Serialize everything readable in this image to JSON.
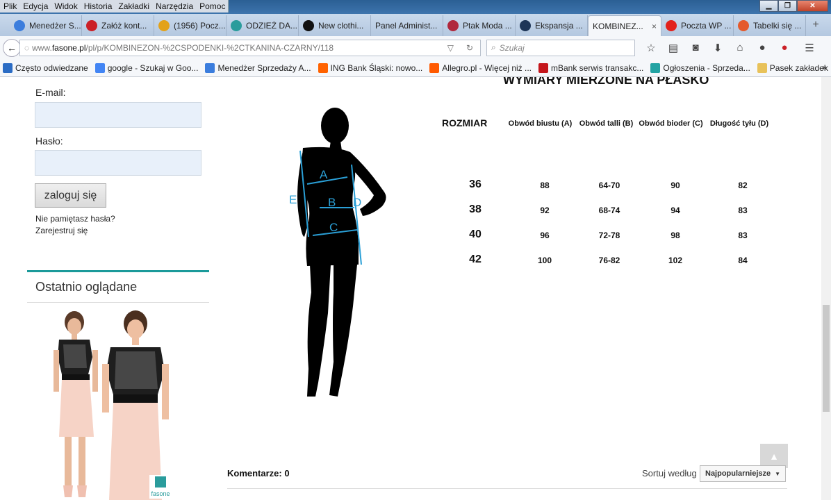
{
  "menubar": [
    "Plik",
    "Edycja",
    "Widok",
    "Historia",
    "Zakładki",
    "Narzędzia",
    "Pomoc"
  ],
  "tabs": [
    {
      "label": "Menedżer S...",
      "icon": "messenger-icon",
      "color": "#3b7ddd"
    },
    {
      "label": "Załóż kont...",
      "icon": "pinterest-icon",
      "color": "#cb2027"
    },
    {
      "label": "(1956) Pocz...",
      "icon": "mail-icon",
      "color": "#e3a21a"
    },
    {
      "label": "ODZIEŻ DA...",
      "icon": "shop-icon",
      "color": "#2a9c9c"
    },
    {
      "label": "New clothi...",
      "icon": "circle-icon",
      "color": "#111111"
    },
    {
      "label": "Panel Administ...",
      "icon": "",
      "color": ""
    },
    {
      "label": "Ptak Moda ...",
      "icon": "bird-icon",
      "color": "#b0283c"
    },
    {
      "label": "Ekspansja ...",
      "icon": "chart-icon",
      "color": "#1d3557"
    },
    {
      "label": "KOMBINEZ...",
      "icon": "",
      "color": "",
      "active": true
    },
    {
      "label": "Poczta WP ...",
      "icon": "wp-icon",
      "color": "#e2211c"
    },
    {
      "label": "Tabelki się ...",
      "icon": "lifebuoy-icon",
      "color": "#e45a2c"
    }
  ],
  "close_glyph": "×",
  "newtab_glyph": "+",
  "url": {
    "prefix": "www.",
    "host": "fasone.pl",
    "path": "/pl/p/KOMBINEZON-%2CSPODENKI-%2CTKANINA-CZARNY/118"
  },
  "search_placeholder": "Szukaj",
  "bookmarks": [
    {
      "label": "Często odwiedzane",
      "color": "#2b6cc4"
    },
    {
      "label": "google - Szukaj w Goo...",
      "color": "#4285f4"
    },
    {
      "label": "Menedżer Sprzedaży A...",
      "color": "#3b7ddd"
    },
    {
      "label": "ING Bank Śląski: nowo...",
      "color": "#ff6200"
    },
    {
      "label": "Allegro.pl - Więcej niż ...",
      "color": "#ff5a00"
    },
    {
      "label": "mBank serwis transakc...",
      "color": "#c4161c"
    },
    {
      "label": "Ogłoszenia - Sprzeda...",
      "color": "#23a3a3"
    },
    {
      "label": "Pasek zakładek",
      "color": "#e8c25a"
    }
  ],
  "login": {
    "email_label": "E-mail:",
    "password_label": "Hasło:",
    "button": "zaloguj się",
    "forgot": "Nie pamiętasz hasła?",
    "register": "Zarejestruj się"
  },
  "recent_title": "Ostatnio oglądane",
  "recent_logo": "fasone",
  "size_table": {
    "title": "WYMIARY MIERZONE NA PŁASKO",
    "size_header": "ROZMIAR",
    "headers": [
      "Obwód biustu (A)",
      "Obwód talli (B)",
      "Obwód bioder (C)",
      "Długość tyłu (D)"
    ],
    "rows": [
      {
        "size": "36",
        "values": [
          "88",
          "64-70",
          "90",
          "82"
        ]
      },
      {
        "size": "38",
        "values": [
          "92",
          "68-74",
          "94",
          "83"
        ]
      },
      {
        "size": "40",
        "values": [
          "96",
          "72-78",
          "98",
          "83"
        ]
      },
      {
        "size": "42",
        "values": [
          "100",
          "76-82",
          "102",
          "84"
        ]
      }
    ]
  },
  "figure_labels": {
    "a": "A",
    "b": "B",
    "c": "C",
    "d": "D",
    "e": "E"
  },
  "comments_label": "Komentarze: 0",
  "sort": {
    "label": "Sortuj według",
    "selected": "Najpopularniejsze"
  }
}
